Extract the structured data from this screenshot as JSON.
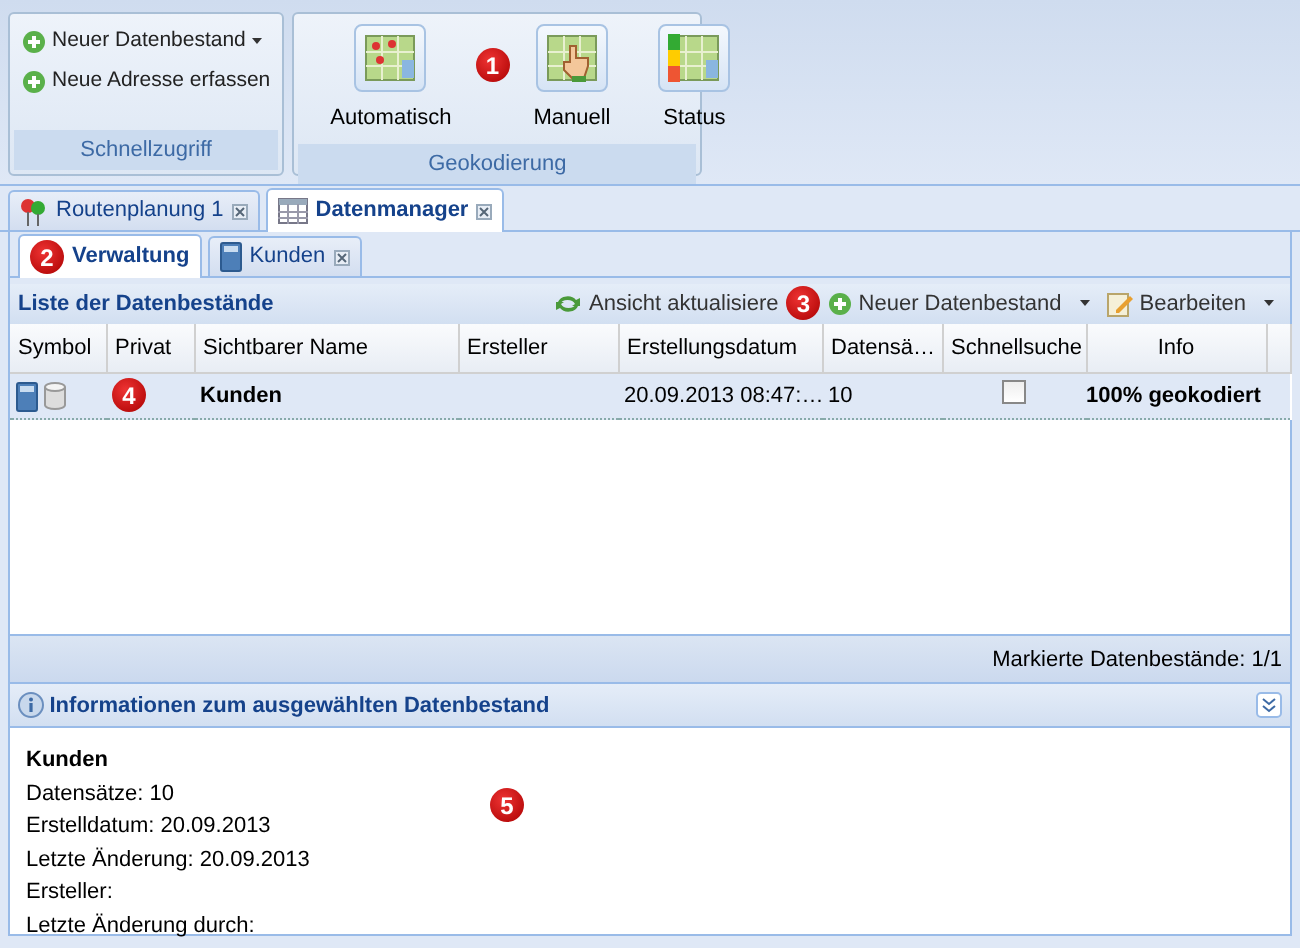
{
  "ribbon": {
    "groups": [
      {
        "title": "Schnellzugriff",
        "kind": "links",
        "items": [
          {
            "label": "Neuer Datenbestand",
            "dropdown": true
          },
          {
            "label": "Neue Adresse erfassen",
            "dropdown": false
          }
        ]
      },
      {
        "title": "Geokodierung",
        "kind": "big",
        "callout": "1",
        "items": [
          {
            "label": "Automatisch"
          },
          {
            "label": "Manuell"
          },
          {
            "label": "Status"
          }
        ]
      }
    ]
  },
  "main_tabs": [
    {
      "label": "Routenplanung 1",
      "selected": false
    },
    {
      "label": "Datenmanager",
      "selected": true
    }
  ],
  "sub_tabs": [
    {
      "label": "Verwaltung",
      "selected": true,
      "closable": false,
      "callout": "2"
    },
    {
      "label": "Kunden",
      "selected": false,
      "closable": true
    }
  ],
  "list_panel": {
    "title": "Liste der Datenbestände",
    "toolbar": [
      {
        "label": "Ansicht aktualisiere",
        "dropdown": false,
        "callout": "3"
      },
      {
        "label": "Neuer Datenbestand",
        "dropdown": true
      },
      {
        "label": "Bearbeiten",
        "dropdown": true
      }
    ],
    "columns": [
      "Symbol",
      "Privat",
      "Sichtbarer Name",
      "Ersteller",
      "Erstellungsdatum",
      "Datensä…",
      "Schnellsuche",
      "Info"
    ],
    "rows": [
      {
        "selected": true,
        "callout": "4",
        "name": "Kunden",
        "creator": "",
        "created": "20.09.2013 08:47:…",
        "records": "10",
        "quick_search": false,
        "info": "100% geokodiert"
      }
    ],
    "status": "Markierte Datenbestände: 1/1"
  },
  "info_panel": {
    "title": "Informationen zum ausgewählten Datenbestand",
    "heading": "Kunden",
    "lines": [
      "Datensätze: 10",
      "Erstelldatum: 20.09.2013",
      "Letzte Änderung: 20.09.2013",
      "Ersteller:",
      "Letzte Änderung durch:"
    ],
    "callout": "5"
  }
}
